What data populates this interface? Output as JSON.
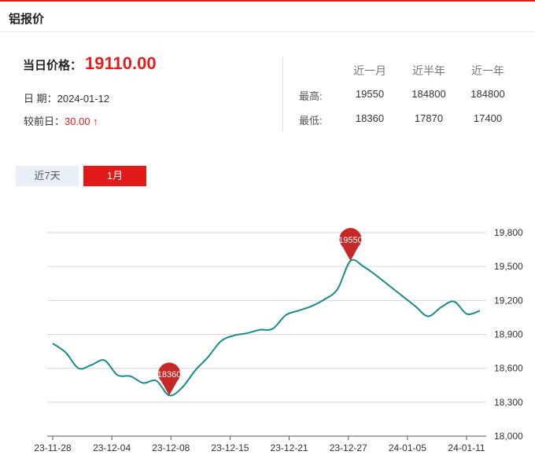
{
  "header": {
    "title": "铝报价"
  },
  "price": {
    "label": "当日价格：",
    "value": "19110.00"
  },
  "date": {
    "label": "日 期：",
    "value": "2024-01-12"
  },
  "change": {
    "label": "较前日：",
    "value": "30.00 ↑"
  },
  "stats": {
    "columns": [
      "近一月",
      "近半年",
      "近一年"
    ],
    "rows": [
      {
        "label": "最高:",
        "values": [
          "19550",
          "184800",
          "184800"
        ]
      },
      {
        "label": "最低:",
        "values": [
          "18360",
          "17870",
          "17400"
        ]
      }
    ]
  },
  "tabs": [
    {
      "label": "近7天",
      "active": false
    },
    {
      "label": "1月",
      "active": true
    }
  ],
  "colors": {
    "accent": "#e21a1a",
    "line": "#1a8a8c",
    "pin": "#c62828",
    "grid": "#d6d6d6"
  },
  "chart_data": {
    "type": "line",
    "x_ticks": [
      "23-11-28",
      "23-12-04",
      "23-12-08",
      "23-12-15",
      "23-12-21",
      "23-12-27",
      "24-01-05",
      "24-01-11"
    ],
    "y_ticks": [
      "19,800",
      "19,500",
      "19,200",
      "18,900",
      "18,600",
      "18,300",
      "18,000"
    ],
    "ylim": [
      18000,
      19800
    ],
    "grid": true,
    "series": [
      {
        "values": [
          18820,
          18740,
          18600,
          18630,
          18670,
          18540,
          18530,
          18470,
          18490,
          18360,
          18430,
          18580,
          18700,
          18840,
          18890,
          18910,
          18940,
          18950,
          19070,
          19110,
          19150,
          19210,
          19300,
          19550,
          19500,
          19420,
          19330,
          19240,
          19150,
          19060,
          19140,
          19190,
          19080,
          19110
        ]
      }
    ],
    "annotations": [
      {
        "label": "19550",
        "value": 19550
      },
      {
        "label": "18360",
        "value": 18360
      }
    ]
  }
}
